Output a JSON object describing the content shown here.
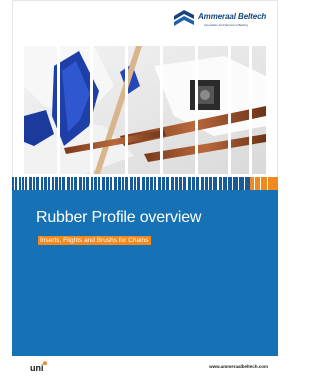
{
  "brand": {
    "name": "Ammeraal Beltech",
    "tagline": "Innovation and Service in Belting"
  },
  "cover": {
    "title": "Rubber Profile overview",
    "subtitle": "Inserts, Flights and Brushs for Chains"
  },
  "footer": {
    "logo_text": "uni",
    "url": "www.ammeraalbeltech.com"
  },
  "colors": {
    "banner_blue": "#1672b4",
    "strip_blue": "#175a9a",
    "accent_orange": "#f08a1e",
    "brand_navy": "#15457c"
  }
}
